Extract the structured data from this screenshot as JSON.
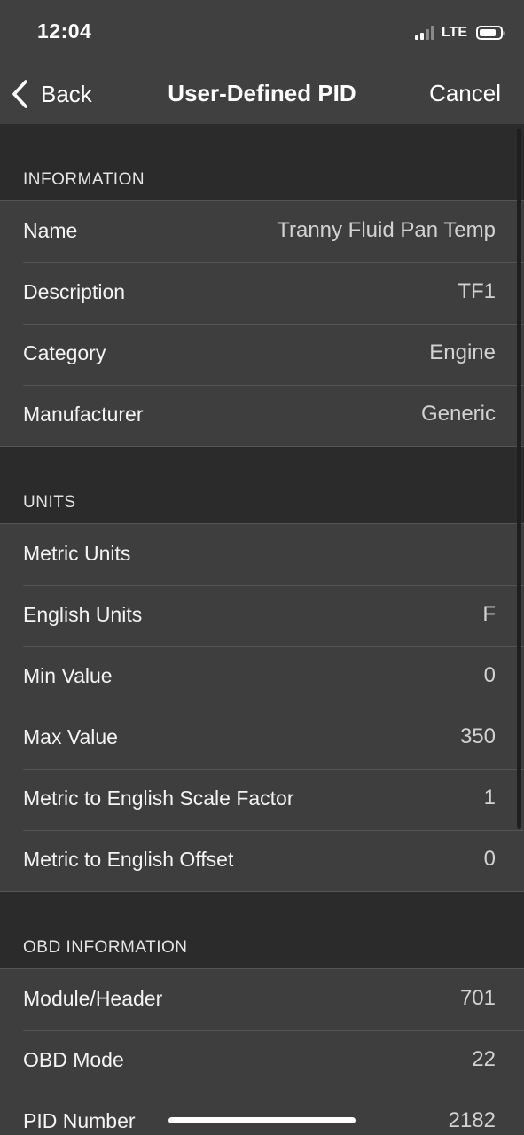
{
  "status_bar": {
    "time": "12:04",
    "network": "LTE",
    "signal_icon": "cellular-signal-icon",
    "signal_bars_filled": 2,
    "signal_bars_total": 4,
    "battery_icon": "battery-icon",
    "battery_level": 0.8
  },
  "nav": {
    "back_icon": "chevron-left-icon",
    "back_label": "Back",
    "title": "User-Defined PID",
    "cancel_label": "Cancel"
  },
  "sections": [
    {
      "header": "INFORMATION",
      "rows": [
        {
          "label": "Name",
          "value": "Tranny Fluid Pan Temp"
        },
        {
          "label": "Description",
          "value": "TF1"
        },
        {
          "label": "Category",
          "value": "Engine"
        },
        {
          "label": "Manufacturer",
          "value": "Generic"
        }
      ]
    },
    {
      "header": "UNITS",
      "rows": [
        {
          "label": "Metric Units",
          "value": ""
        },
        {
          "label": "English Units",
          "value": "F"
        },
        {
          "label": "Min Value",
          "value": "0"
        },
        {
          "label": "Max Value",
          "value": "350"
        },
        {
          "label": "Metric to English Scale Factor",
          "value": "1"
        },
        {
          "label": "Metric to English Offset",
          "value": "0"
        }
      ]
    },
    {
      "header": "OBD INFORMATION",
      "rows": [
        {
          "label": "Module/Header",
          "value": "701"
        },
        {
          "label": "OBD Mode",
          "value": "22"
        },
        {
          "label": "PID Number",
          "value": "2182"
        }
      ]
    }
  ],
  "colors": {
    "background": "#2b2b2b",
    "bar": "#404040",
    "row": "#3e3e3e",
    "separator": "#545454",
    "text": "#f4f4f4",
    "value_text": "#d2d2d2"
  }
}
